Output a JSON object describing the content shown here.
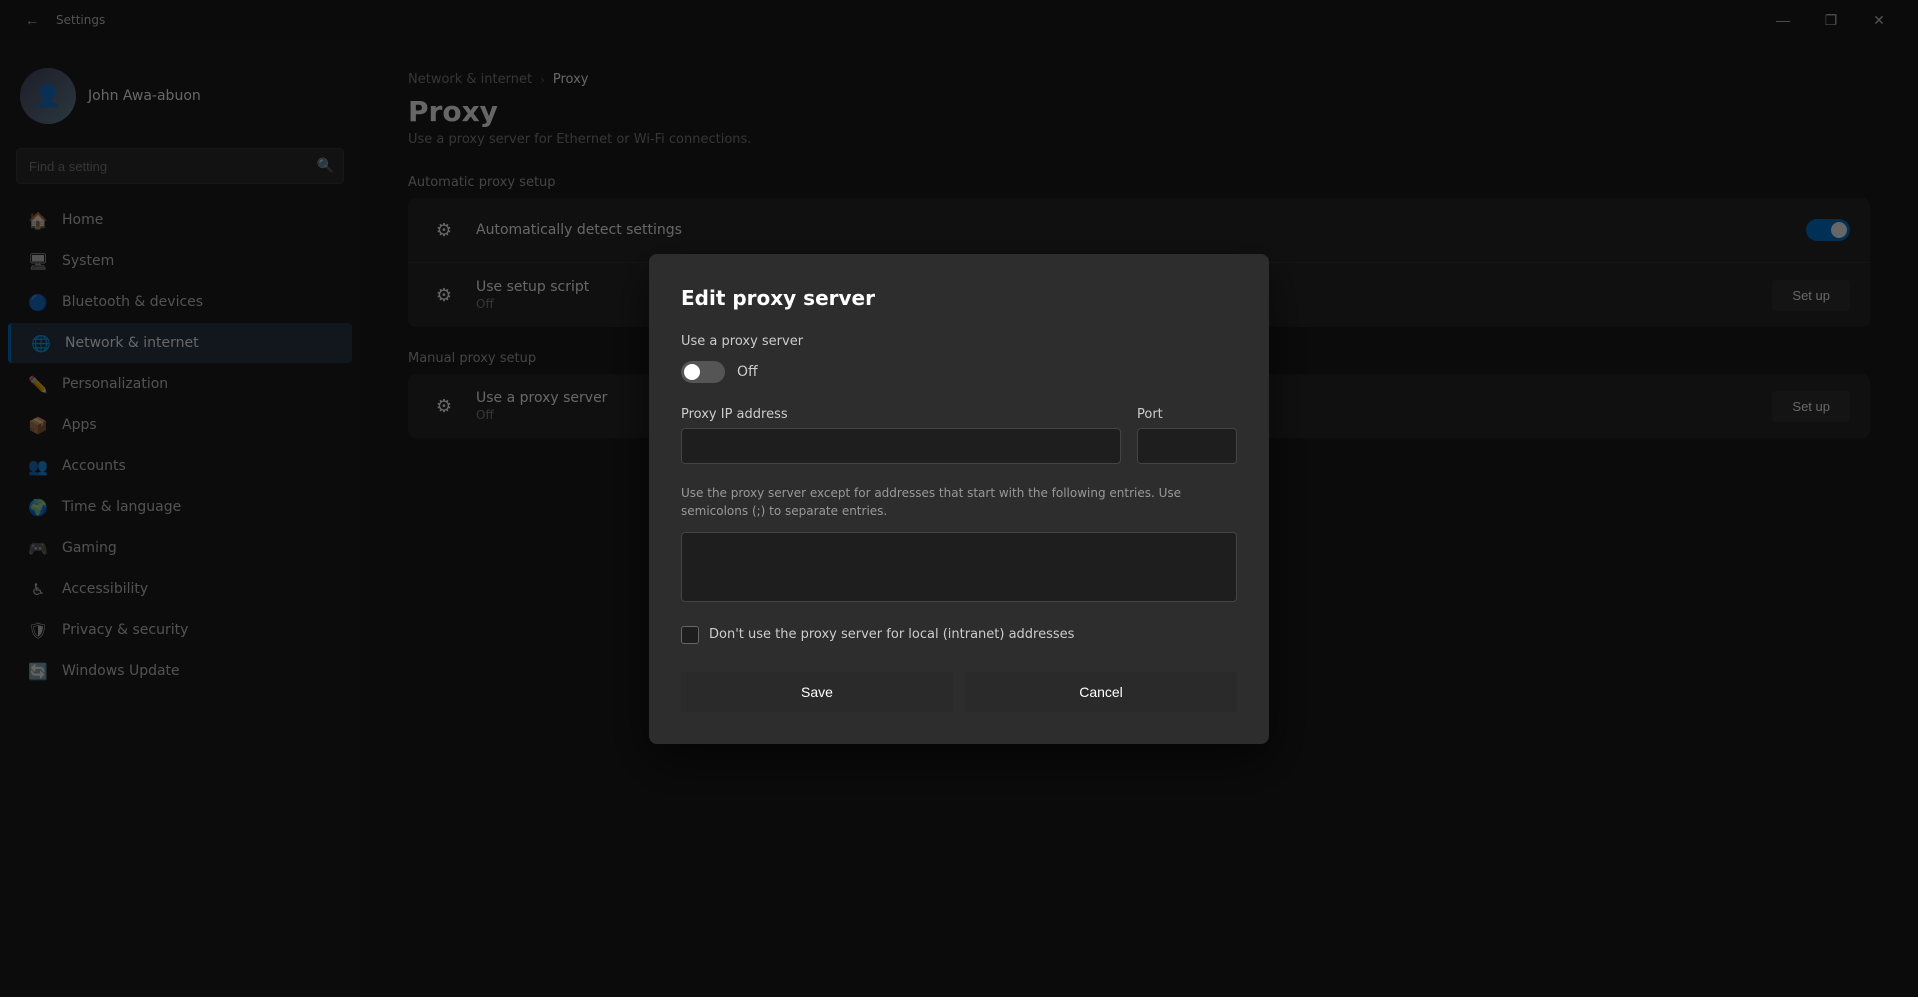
{
  "titlebar": {
    "title": "Settings",
    "minimize": "—",
    "restore": "❐",
    "close": "✕"
  },
  "sidebar": {
    "user": {
      "name": "John Awa-abuon",
      "avatar_char": "👤"
    },
    "search": {
      "placeholder": "Find a setting"
    },
    "nav_items": [
      {
        "id": "home",
        "icon": "🏠",
        "label": "Home",
        "active": false
      },
      {
        "id": "system",
        "icon": "🖥",
        "label": "System",
        "active": false
      },
      {
        "id": "bluetooth",
        "icon": "🔵",
        "label": "Bluetooth & devices",
        "active": false
      },
      {
        "id": "network",
        "icon": "🌐",
        "label": "Network & internet",
        "active": true
      },
      {
        "id": "personalization",
        "icon": "✏️",
        "label": "Personalization",
        "active": false
      },
      {
        "id": "apps",
        "icon": "📦",
        "label": "Apps",
        "active": false
      },
      {
        "id": "accounts",
        "icon": "👥",
        "label": "Accounts",
        "active": false
      },
      {
        "id": "time",
        "icon": "🌍",
        "label": "Time & language",
        "active": false
      },
      {
        "id": "gaming",
        "icon": "🎮",
        "label": "Gaming",
        "active": false
      },
      {
        "id": "accessibility",
        "icon": "♿",
        "label": "Accessibility",
        "active": false
      },
      {
        "id": "privacy",
        "icon": "🛡",
        "label": "Privacy & security",
        "active": false
      },
      {
        "id": "update",
        "icon": "🔄",
        "label": "Windows Update",
        "active": false
      }
    ]
  },
  "main": {
    "breadcrumb": {
      "parent": "Network & internet",
      "separator": "›",
      "current": "Proxy"
    },
    "title": "Proxy",
    "description": "Use a proxy server for Ethernet or Wi-Fi connections.",
    "sections": {
      "auto": {
        "label": "Automatic proxy setup",
        "rows": [
          {
            "icon": "⚙",
            "title": "Automatically detect settings",
            "sub": "",
            "toggle": "on",
            "action": ""
          },
          {
            "icon": "⚙",
            "title": "Use setup script",
            "sub": "Off",
            "toggle": "",
            "action": "Set up"
          }
        ]
      },
      "manual": {
        "label": "Manual proxy setup",
        "rows": [
          {
            "icon": "⚙",
            "title": "Use a proxy server",
            "sub": "Off",
            "toggle": "",
            "action": "Set up"
          }
        ]
      }
    }
  },
  "modal": {
    "title": "Edit proxy server",
    "toggle_section_label": "Use a proxy server",
    "toggle_state": "off",
    "toggle_text": "Off",
    "proxy_ip_label": "Proxy IP address",
    "port_label": "Port",
    "proxy_ip_value": "",
    "port_value": "",
    "hint_text": "Use the proxy server except for addresses that start with the following entries. Use semicolons (;) to separate entries.",
    "exceptions_value": "",
    "checkbox_label": "Don't use the proxy server for local (intranet) addresses",
    "checkbox_checked": false,
    "save_label": "Save",
    "cancel_label": "Cancel"
  }
}
